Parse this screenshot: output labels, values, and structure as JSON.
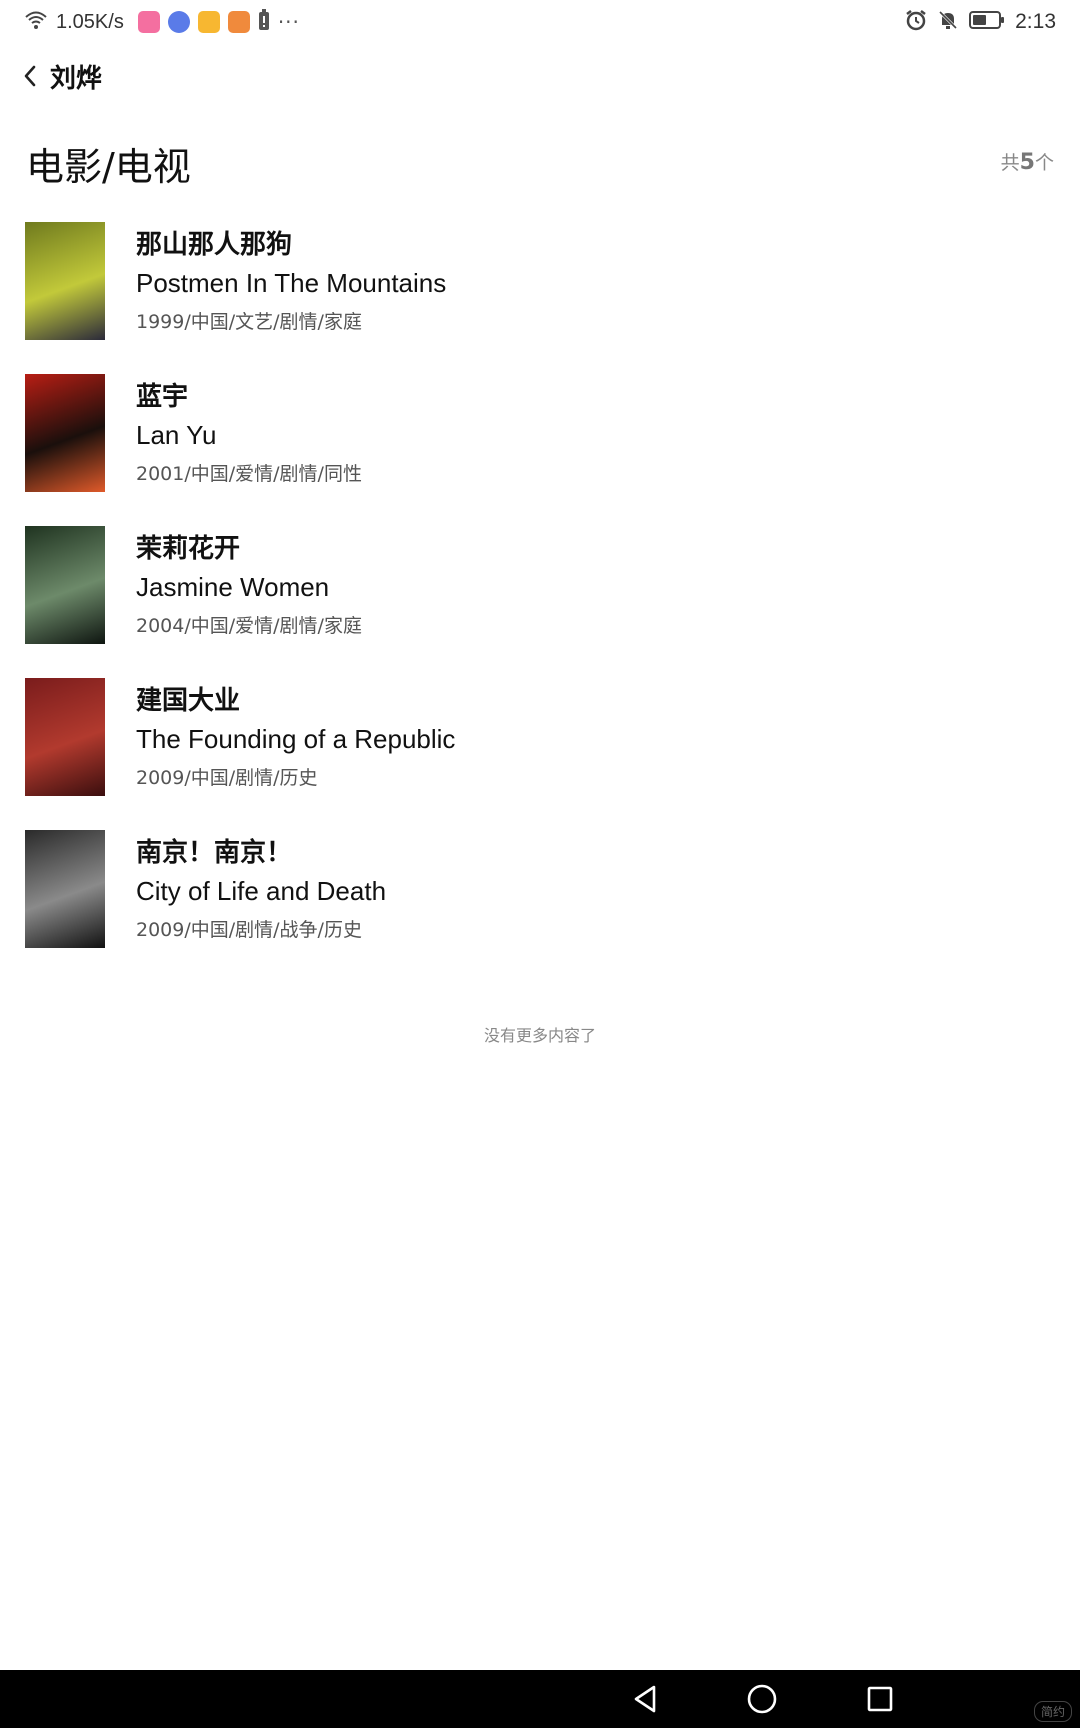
{
  "status_bar": {
    "network_speed": "1.05K/s",
    "more": "···",
    "time": "2:13",
    "app_icons": [
      {
        "name": "bilibili-icon",
        "color": "#f46fa0"
      },
      {
        "name": "music-icon",
        "color": "#5a7be8"
      },
      {
        "name": "folder-icon",
        "color": "#f7b731"
      },
      {
        "name": "game-icon",
        "color": "#f08a3c"
      }
    ]
  },
  "nav": {
    "title": "刘烨"
  },
  "section": {
    "title": "电影/电视",
    "count_prefix": "共",
    "count_num": "5",
    "count_suffix": "个"
  },
  "movies": [
    {
      "title_cn": "那山那人那狗",
      "title_en": "Postmen In The Mountains",
      "meta": "1999/中国/文艺/剧情/家庭",
      "poster_colors": [
        "#6f7a1e",
        "#c2c93a",
        "#2b2a3a"
      ]
    },
    {
      "title_cn": "蓝宇",
      "title_en": "Lan Yu",
      "meta": "2001/中国/爱情/剧情/同性",
      "poster_colors": [
        "#b81e14",
        "#1a0f0c",
        "#e05a2a"
      ]
    },
    {
      "title_cn": "茉莉花开",
      "title_en": "Jasmine Women",
      "meta": "2004/中国/爱情/剧情/家庭",
      "poster_colors": [
        "#1f3320",
        "#6d8a6a",
        "#0e1510"
      ]
    },
    {
      "title_cn": "建国大业",
      "title_en": "The Founding of a Republic",
      "meta": "2009/中国/剧情/历史",
      "poster_colors": [
        "#7a1c1c",
        "#b23a2e",
        "#3a0e0e"
      ]
    },
    {
      "title_cn": "南京！南京！",
      "title_en": "City of Life and Death",
      "meta": "2009/中国/剧情/战争/历史",
      "poster_colors": [
        "#2a2a2a",
        "#8a8a8a",
        "#111111"
      ]
    }
  ],
  "end_message": "没有更多内容了",
  "sys_nav": {
    "watermark": "简约"
  }
}
